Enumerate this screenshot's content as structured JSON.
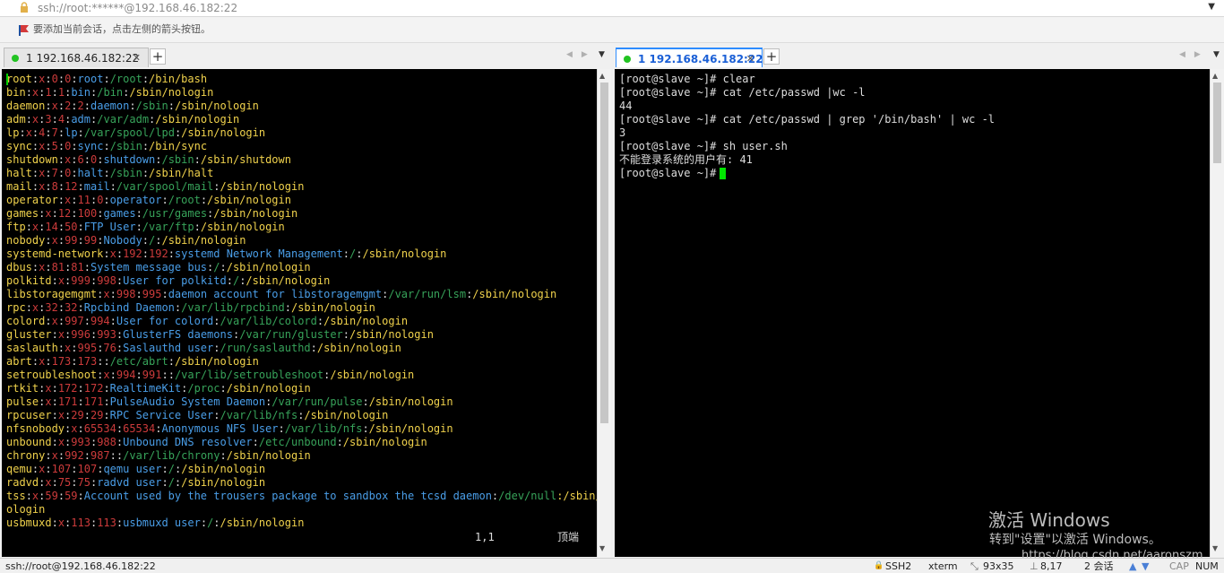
{
  "address_bar": {
    "text": "ssh://root:******@192.168.46.182:22"
  },
  "hint_bar": {
    "text": "要添加当前会话，点击左侧的箭头按钮。"
  },
  "left_pane": {
    "tab_label": "1 192.168.46.182:22",
    "lines": [
      [
        "root",
        "x",
        "0",
        "0",
        "root",
        "/root",
        "/bin/bash"
      ],
      [
        "bin",
        "x",
        "1",
        "1",
        "bin",
        "/bin",
        "/sbin/nologin"
      ],
      [
        "daemon",
        "x",
        "2",
        "2",
        "daemon",
        "/sbin",
        "/sbin/nologin"
      ],
      [
        "adm",
        "x",
        "3",
        "4",
        "adm",
        "/var/adm",
        "/sbin/nologin"
      ],
      [
        "lp",
        "x",
        "4",
        "7",
        "lp",
        "/var/spool/lpd",
        "/sbin/nologin"
      ],
      [
        "sync",
        "x",
        "5",
        "0",
        "sync",
        "/sbin",
        "/bin/sync"
      ],
      [
        "shutdown",
        "x",
        "6",
        "0",
        "shutdown",
        "/sbin",
        "/sbin/shutdown"
      ],
      [
        "halt",
        "x",
        "7",
        "0",
        "halt",
        "/sbin",
        "/sbin/halt"
      ],
      [
        "mail",
        "x",
        "8",
        "12",
        "mail",
        "/var/spool/mail",
        "/sbin/nologin"
      ],
      [
        "operator",
        "x",
        "11",
        "0",
        "operator",
        "/root",
        "/sbin/nologin"
      ],
      [
        "games",
        "x",
        "12",
        "100",
        "games",
        "/usr/games",
        "/sbin/nologin"
      ],
      [
        "ftp",
        "x",
        "14",
        "50",
        "FTP User",
        "/var/ftp",
        "/sbin/nologin"
      ],
      [
        "nobody",
        "x",
        "99",
        "99",
        "Nobody",
        "/",
        "/sbin/nologin"
      ],
      [
        "systemd-network",
        "x",
        "192",
        "192",
        "systemd Network Management",
        "/",
        "/sbin/nologin"
      ],
      [
        "dbus",
        "x",
        "81",
        "81",
        "System message bus",
        "/",
        "/sbin/nologin"
      ],
      [
        "polkitd",
        "x",
        "999",
        "998",
        "User for polkitd",
        "/",
        "/sbin/nologin"
      ],
      [
        "libstoragemgmt",
        "x",
        "998",
        "995",
        "daemon account for libstoragemgmt",
        "/var/run/lsm",
        "/sbin/nologin"
      ],
      [
        "rpc",
        "x",
        "32",
        "32",
        "Rpcbind Daemon",
        "/var/lib/rpcbind",
        "/sbin/nologin"
      ],
      [
        "colord",
        "x",
        "997",
        "994",
        "User for colord",
        "/var/lib/colord",
        "/sbin/nologin"
      ],
      [
        "gluster",
        "x",
        "996",
        "993",
        "GlusterFS daemons",
        "/var/run/gluster",
        "/sbin/nologin"
      ],
      [
        "saslauth",
        "x",
        "995",
        "76",
        "Saslauthd user",
        "/run/saslauthd",
        "/sbin/nologin"
      ],
      [
        "abrt",
        "x",
        "173",
        "173",
        "",
        "/etc/abrt",
        "/sbin/nologin"
      ],
      [
        "setroubleshoot",
        "x",
        "994",
        "991",
        "",
        "/var/lib/setroubleshoot",
        "/sbin/nologin"
      ],
      [
        "rtkit",
        "x",
        "172",
        "172",
        "RealtimeKit",
        "/proc",
        "/sbin/nologin"
      ],
      [
        "pulse",
        "x",
        "171",
        "171",
        "PulseAudio System Daemon",
        "/var/run/pulse",
        "/sbin/nologin"
      ],
      [
        "rpcuser",
        "x",
        "29",
        "29",
        "RPC Service User",
        "/var/lib/nfs",
        "/sbin/nologin"
      ],
      [
        "nfsnobody",
        "x",
        "65534",
        "65534",
        "Anonymous NFS User",
        "/var/lib/nfs",
        "/sbin/nologin"
      ],
      [
        "unbound",
        "x",
        "993",
        "988",
        "Unbound DNS resolver",
        "/etc/unbound",
        "/sbin/nologin"
      ],
      [
        "chrony",
        "x",
        "992",
        "987",
        "",
        "/var/lib/chrony",
        "/sbin/nologin"
      ],
      [
        "qemu",
        "x",
        "107",
        "107",
        "qemu user",
        "/",
        "/sbin/nologin"
      ],
      [
        "radvd",
        "x",
        "75",
        "75",
        "radvd user",
        "/",
        "/sbin/nologin"
      ]
    ],
    "wrap_line_a": [
      "tss",
      "x",
      "59",
      "59",
      "Account used by the trousers package to sandbox the tcsd daemon",
      "/dev/null",
      ":/sbin/n"
    ],
    "wrap_line_b": "ologin",
    "last_line": [
      "usbmuxd",
      "x",
      "113",
      "113",
      "usbmuxd user",
      "/",
      "/sbin/nologin"
    ],
    "vim_position": "1,1",
    "vim_scroll": "顶端",
    "scroll_fraction": 0.0
  },
  "right_pane": {
    "tab_label": "1 192.168.46.182:22",
    "lines": [
      "[root@slave ~]# clear",
      "[root@slave ~]# cat /etc/passwd |wc -l",
      "44",
      "[root@slave ~]# cat /etc/passwd | grep '/bin/bash' | wc -l",
      "3",
      "[root@slave ~]# sh user.sh",
      "不能登录系统的用户有: 41",
      "[root@slave ~]# "
    ]
  },
  "watermark": {
    "line1": "激活 Windows",
    "line2": "转到\"设置\"以激活 Windows。",
    "line3": "https://blog.csdn.net/aaronszm"
  },
  "status_bar": {
    "connection": "ssh://root@192.168.46.182:22",
    "protocol": "SSH2",
    "terminal": "xterm",
    "size": "93x35",
    "cursor": "8,17",
    "sessions": "2 会话",
    "caps": "CAP",
    "num": "NUM"
  },
  "colors": {
    "terminal_bg": "#000000",
    "field_user": "#f0d24c",
    "field_id": "#cc3b3b",
    "field_gecos": "#4a9ee8",
    "field_home": "#37a35a",
    "cursor": "#00e600",
    "tab_dot": "#22c322"
  }
}
